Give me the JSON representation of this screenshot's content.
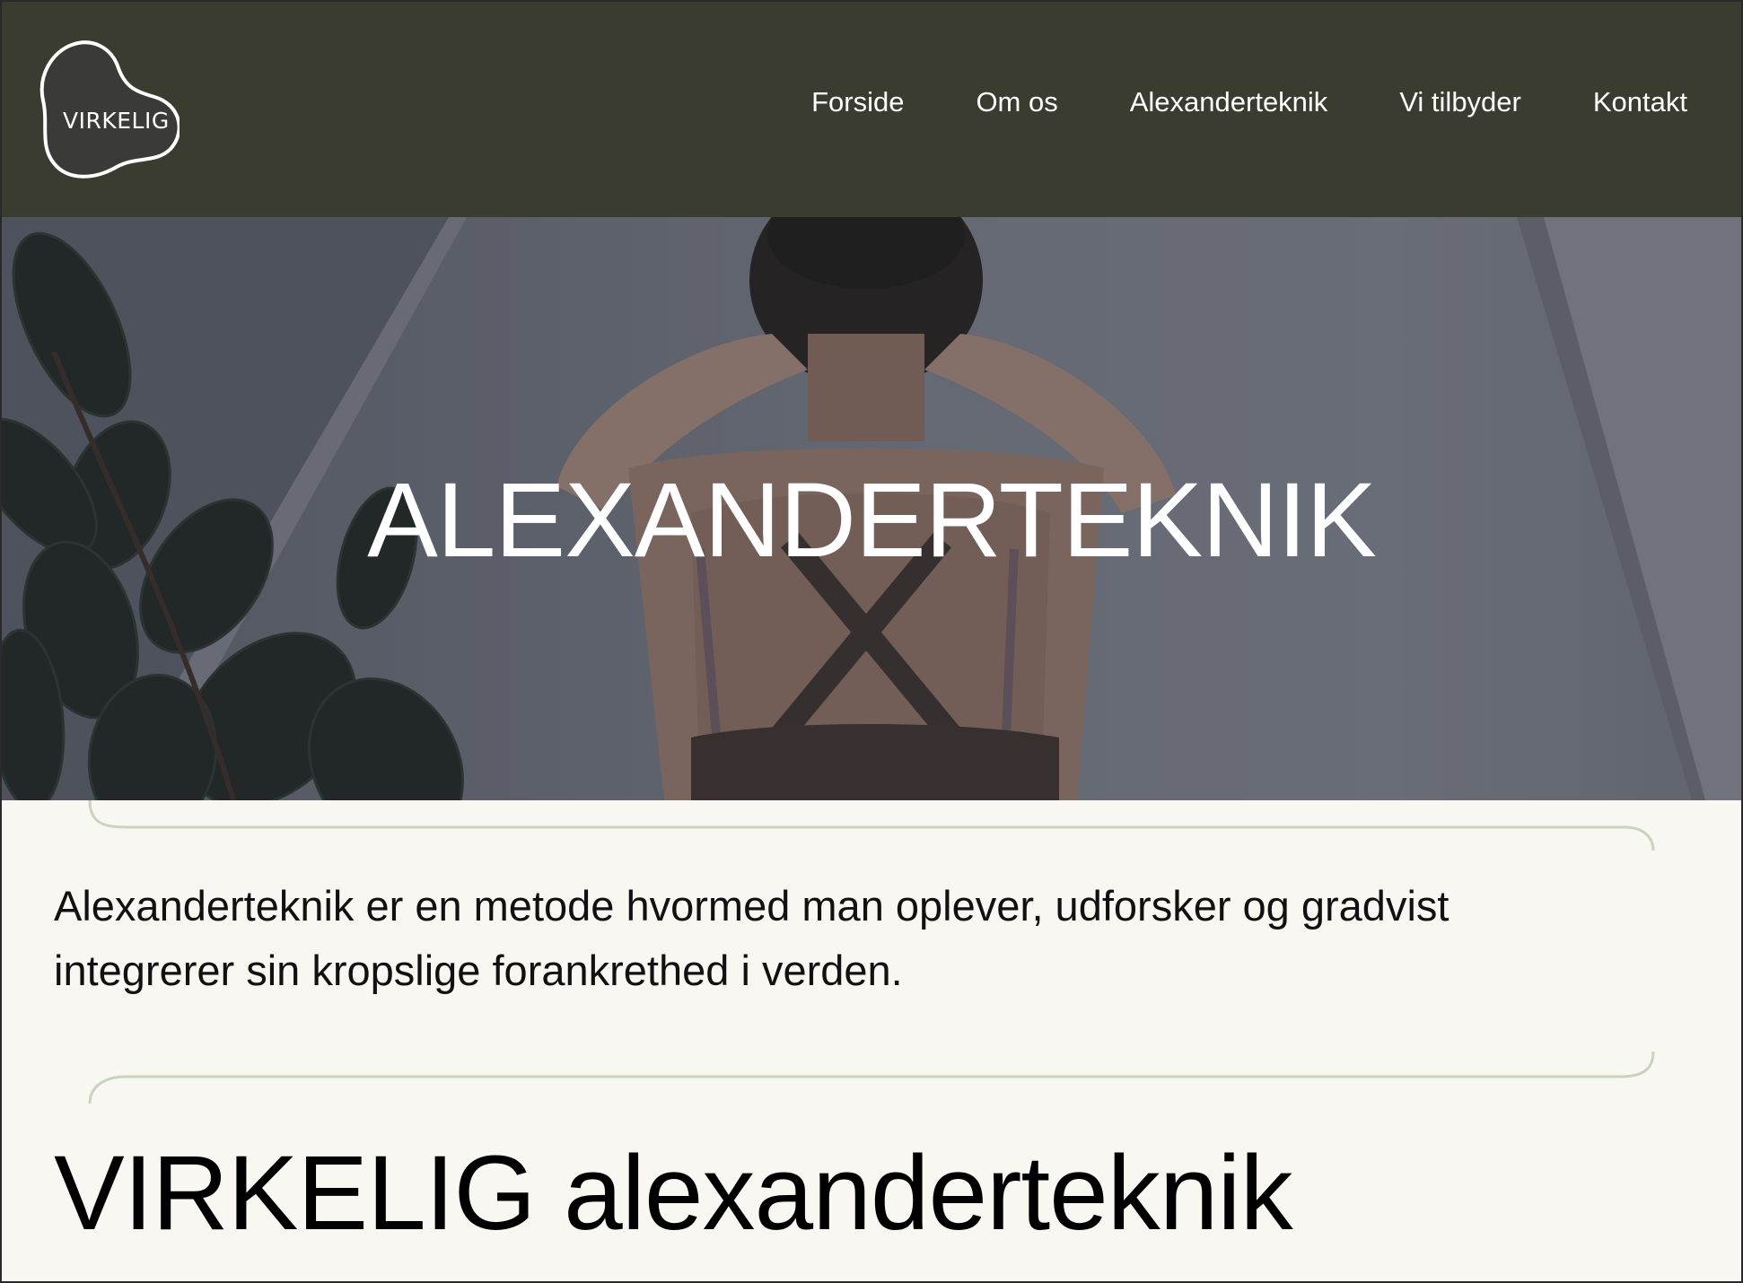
{
  "header": {
    "logo_text": "VIRKELIG",
    "nav": [
      "Forside",
      "Om os",
      "Alexanderteknik",
      "Vi tilbyder",
      "Kontakt"
    ]
  },
  "hero": {
    "title": "ALEXANDERTEKNIK"
  },
  "content": {
    "intro": "Alexanderteknik er en metode hvormed man oplever, udforsker og gradvist integrerer sin kropslige forankrethed i verden.",
    "section_heading": "VIRKELIG alexanderteknik"
  },
  "colors": {
    "header_bg": "#3b3c30",
    "page_bg": "#f8f7f2",
    "accent_line": "#c9d3bd"
  }
}
